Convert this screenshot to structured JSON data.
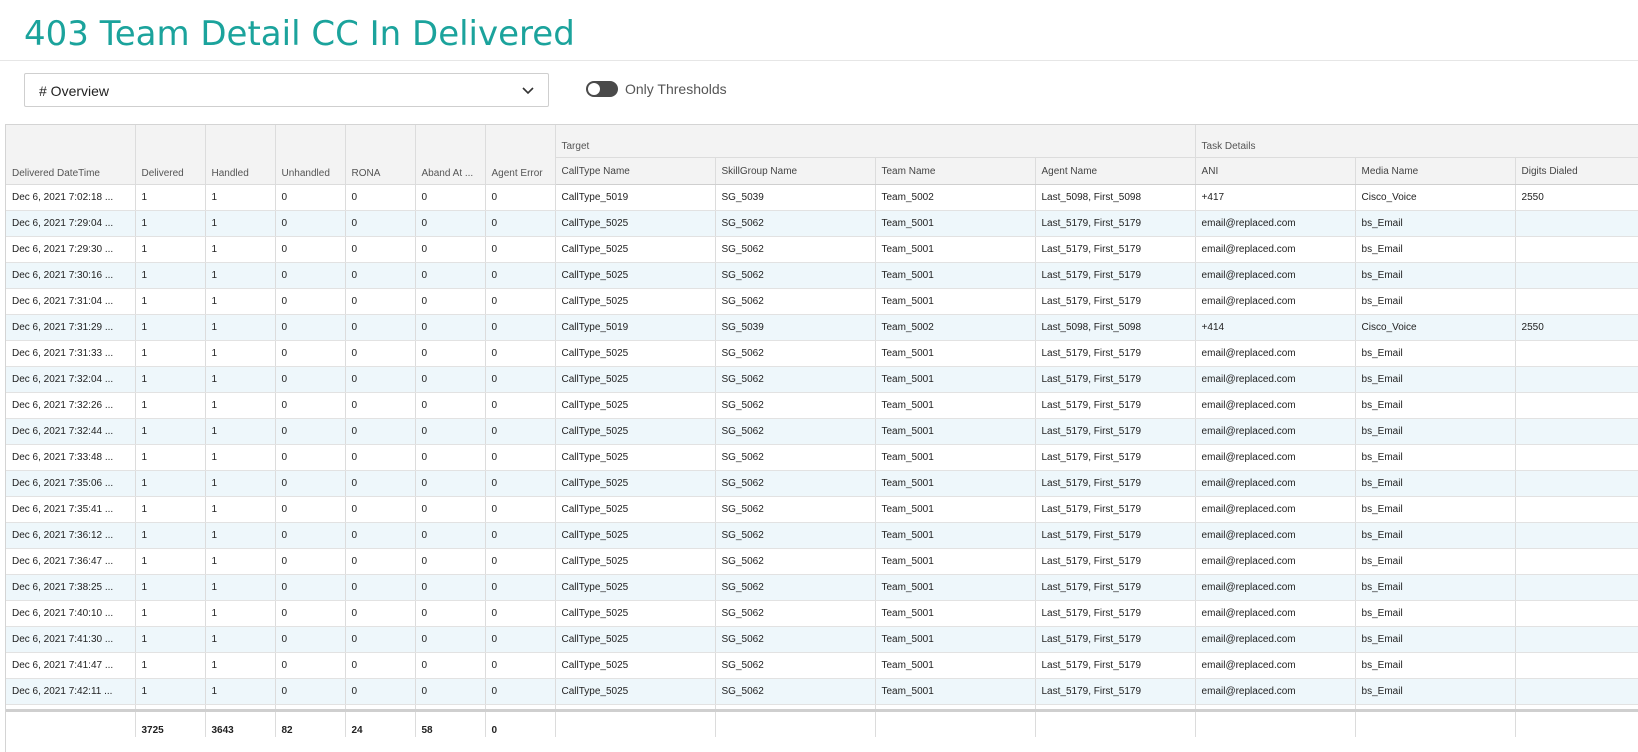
{
  "page": {
    "title": "403 Team Detail CC In Delivered"
  },
  "controls": {
    "view_select_value": "# Overview",
    "threshold_toggle_label": "Only Thresholds"
  },
  "grid": {
    "groups": {
      "target": "Target",
      "task_details": "Task Details"
    },
    "columns": [
      "Delivered DateTime",
      "Delivered",
      "Handled",
      "Unhandled",
      "RONA",
      "Aband At ...",
      "Agent Error",
      "CallType Name",
      "SkillGroup Name",
      "Team Name",
      "Agent Name",
      "ANI",
      "Media Name",
      "Digits Dialed"
    ],
    "rows": [
      [
        "Dec 6, 2021 7:02:18 ...",
        "1",
        "1",
        "0",
        "0",
        "0",
        "0",
        "CallType_5019",
        "SG_5039",
        "Team_5002",
        "Last_5098, First_5098",
        "+417",
        "Cisco_Voice",
        "2550"
      ],
      [
        "Dec 6, 2021 7:29:04 ...",
        "1",
        "1",
        "0",
        "0",
        "0",
        "0",
        "CallType_5025",
        "SG_5062",
        "Team_5001",
        "Last_5179, First_5179",
        "email@replaced.com",
        "bs_Email",
        ""
      ],
      [
        "Dec 6, 2021 7:29:30 ...",
        "1",
        "1",
        "0",
        "0",
        "0",
        "0",
        "CallType_5025",
        "SG_5062",
        "Team_5001",
        "Last_5179, First_5179",
        "email@replaced.com",
        "bs_Email",
        ""
      ],
      [
        "Dec 6, 2021 7:30:16 ...",
        "1",
        "1",
        "0",
        "0",
        "0",
        "0",
        "CallType_5025",
        "SG_5062",
        "Team_5001",
        "Last_5179, First_5179",
        "email@replaced.com",
        "bs_Email",
        ""
      ],
      [
        "Dec 6, 2021 7:31:04 ...",
        "1",
        "1",
        "0",
        "0",
        "0",
        "0",
        "CallType_5025",
        "SG_5062",
        "Team_5001",
        "Last_5179, First_5179",
        "email@replaced.com",
        "bs_Email",
        ""
      ],
      [
        "Dec 6, 2021 7:31:29 ...",
        "1",
        "1",
        "0",
        "0",
        "0",
        "0",
        "CallType_5019",
        "SG_5039",
        "Team_5002",
        "Last_5098, First_5098",
        "+414",
        "Cisco_Voice",
        "2550"
      ],
      [
        "Dec 6, 2021 7:31:33 ...",
        "1",
        "1",
        "0",
        "0",
        "0",
        "0",
        "CallType_5025",
        "SG_5062",
        "Team_5001",
        "Last_5179, First_5179",
        "email@replaced.com",
        "bs_Email",
        ""
      ],
      [
        "Dec 6, 2021 7:32:04 ...",
        "1",
        "1",
        "0",
        "0",
        "0",
        "0",
        "CallType_5025",
        "SG_5062",
        "Team_5001",
        "Last_5179, First_5179",
        "email@replaced.com",
        "bs_Email",
        ""
      ],
      [
        "Dec 6, 2021 7:32:26 ...",
        "1",
        "1",
        "0",
        "0",
        "0",
        "0",
        "CallType_5025",
        "SG_5062",
        "Team_5001",
        "Last_5179, First_5179",
        "email@replaced.com",
        "bs_Email",
        ""
      ],
      [
        "Dec 6, 2021 7:32:44 ...",
        "1",
        "1",
        "0",
        "0",
        "0",
        "0",
        "CallType_5025",
        "SG_5062",
        "Team_5001",
        "Last_5179, First_5179",
        "email@replaced.com",
        "bs_Email",
        ""
      ],
      [
        "Dec 6, 2021 7:33:48 ...",
        "1",
        "1",
        "0",
        "0",
        "0",
        "0",
        "CallType_5025",
        "SG_5062",
        "Team_5001",
        "Last_5179, First_5179",
        "email@replaced.com",
        "bs_Email",
        ""
      ],
      [
        "Dec 6, 2021 7:35:06 ...",
        "1",
        "1",
        "0",
        "0",
        "0",
        "0",
        "CallType_5025",
        "SG_5062",
        "Team_5001",
        "Last_5179, First_5179",
        "email@replaced.com",
        "bs_Email",
        ""
      ],
      [
        "Dec 6, 2021 7:35:41 ...",
        "1",
        "1",
        "0",
        "0",
        "0",
        "0",
        "CallType_5025",
        "SG_5062",
        "Team_5001",
        "Last_5179, First_5179",
        "email@replaced.com",
        "bs_Email",
        ""
      ],
      [
        "Dec 6, 2021 7:36:12 ...",
        "1",
        "1",
        "0",
        "0",
        "0",
        "0",
        "CallType_5025",
        "SG_5062",
        "Team_5001",
        "Last_5179, First_5179",
        "email@replaced.com",
        "bs_Email",
        ""
      ],
      [
        "Dec 6, 2021 7:36:47 ...",
        "1",
        "1",
        "0",
        "0",
        "0",
        "0",
        "CallType_5025",
        "SG_5062",
        "Team_5001",
        "Last_5179, First_5179",
        "email@replaced.com",
        "bs_Email",
        ""
      ],
      [
        "Dec 6, 2021 7:38:25 ...",
        "1",
        "1",
        "0",
        "0",
        "0",
        "0",
        "CallType_5025",
        "SG_5062",
        "Team_5001",
        "Last_5179, First_5179",
        "email@replaced.com",
        "bs_Email",
        ""
      ],
      [
        "Dec 6, 2021 7:40:10 ...",
        "1",
        "1",
        "0",
        "0",
        "0",
        "0",
        "CallType_5025",
        "SG_5062",
        "Team_5001",
        "Last_5179, First_5179",
        "email@replaced.com",
        "bs_Email",
        ""
      ],
      [
        "Dec 6, 2021 7:41:30 ...",
        "1",
        "1",
        "0",
        "0",
        "0",
        "0",
        "CallType_5025",
        "SG_5062",
        "Team_5001",
        "Last_5179, First_5179",
        "email@replaced.com",
        "bs_Email",
        ""
      ],
      [
        "Dec 6, 2021 7:41:47 ...",
        "1",
        "1",
        "0",
        "0",
        "0",
        "0",
        "CallType_5025",
        "SG_5062",
        "Team_5001",
        "Last_5179, First_5179",
        "email@replaced.com",
        "bs_Email",
        ""
      ],
      [
        "Dec 6, 2021 7:42:11 ...",
        "1",
        "1",
        "0",
        "0",
        "0",
        "0",
        "CallType_5025",
        "SG_5062",
        "Team_5001",
        "Last_5179, First_5179",
        "email@replaced.com",
        "bs_Email",
        ""
      ]
    ],
    "totals": [
      "",
      "3725",
      "3643",
      "82",
      "24",
      "58",
      "0",
      "",
      "",
      "",
      "",
      "",
      "",
      ""
    ]
  }
}
